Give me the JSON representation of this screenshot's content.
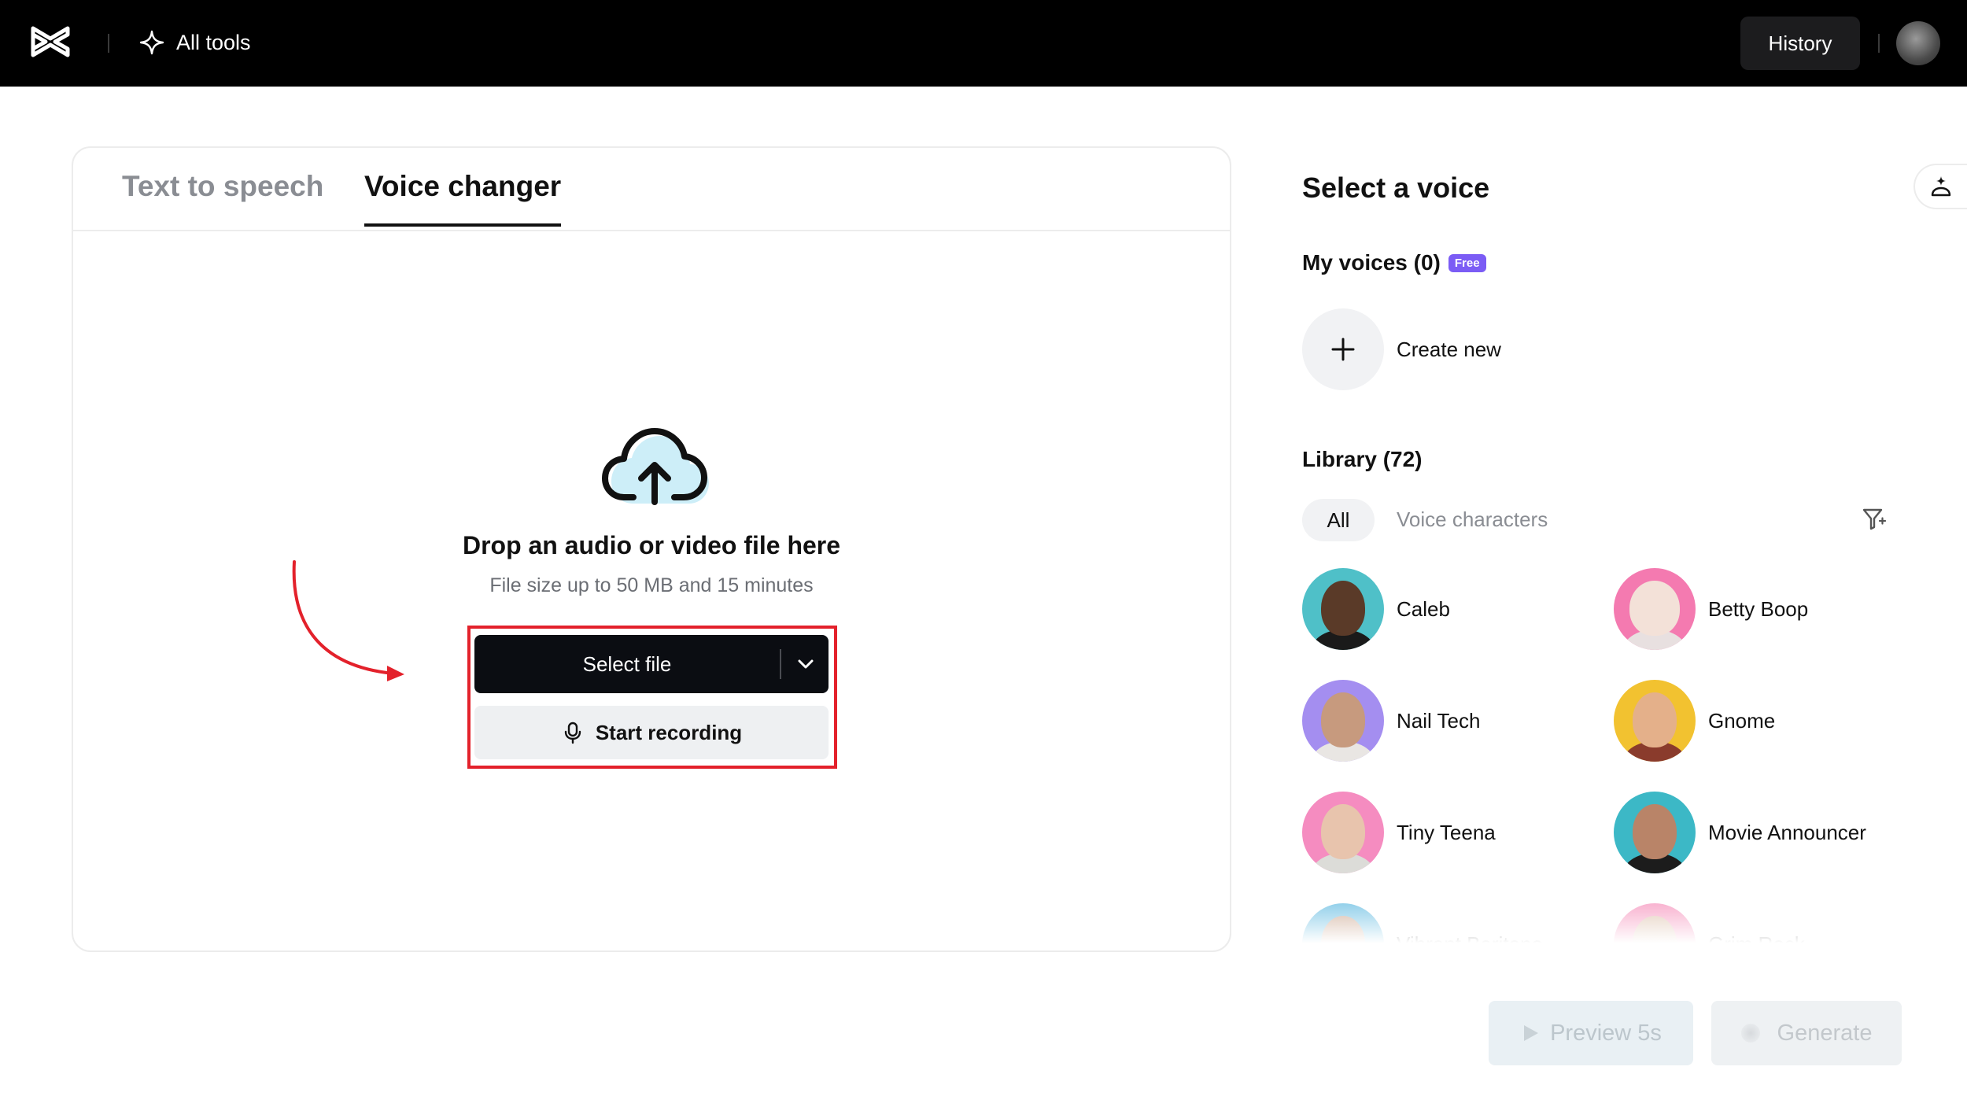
{
  "topbar": {
    "all_tools_label": "All tools",
    "history_label": "History"
  },
  "tabs": {
    "text_to_speech": "Text to speech",
    "voice_changer": "Voice changer"
  },
  "upload": {
    "title": "Drop an audio or video file here",
    "subtitle": "File size up to 50 MB and 15 minutes",
    "select_file_label": "Select file",
    "start_recording_label": "Start recording"
  },
  "right_panel": {
    "title": "Select a voice",
    "my_voices_label": "My voices (0)",
    "free_badge": "Free",
    "create_new_label": "Create new",
    "library_label": "Library (72)",
    "filters": {
      "all": "All",
      "voice_characters": "Voice characters"
    },
    "voices": [
      {
        "name": "Caleb"
      },
      {
        "name": "Betty Boop"
      },
      {
        "name": "Nail Tech"
      },
      {
        "name": "Gnome"
      },
      {
        "name": "Tiny Teena"
      },
      {
        "name": "Movie Announcer"
      },
      {
        "name": "Vibrant Baritone"
      },
      {
        "name": "Grim Rock"
      }
    ]
  },
  "actions": {
    "preview_label": "Preview 5s",
    "generate_label": "Generate"
  },
  "colors": {
    "accent_highlight": "#e3212b",
    "free_badge": "#7b5cf5",
    "primary_button": "#0b0d12"
  }
}
